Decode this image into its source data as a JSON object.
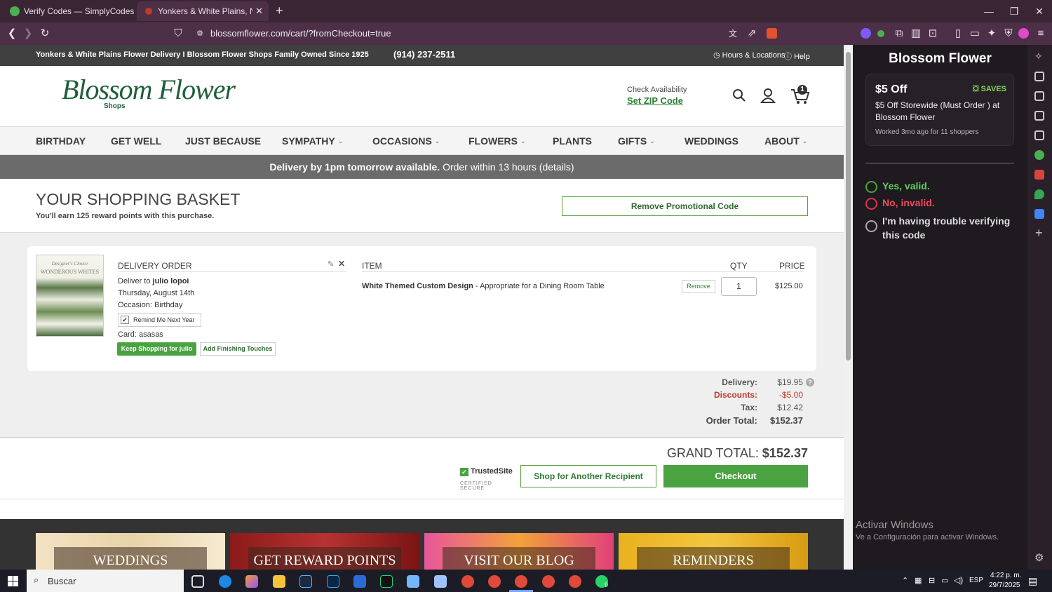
{
  "browser": {
    "tabs": [
      {
        "title": "Verify Codes — SimplyCodes"
      },
      {
        "title": "Yonkers & White Plains, New Yor"
      }
    ],
    "url": "blossomflower.com/cart/?fromCheckout=true"
  },
  "site": {
    "topbar_text": "Yonkers & White Plains Flower Delivery I Blossom Flower Shops Family Owned Since 1925",
    "phone": "(914) 237-2511",
    "hours_label": "Hours & Locations",
    "help_label": "Help",
    "logo_text": "Blossom Flower",
    "logo_sub": "Shops",
    "check_availability": "Check Availability",
    "zip_link": "Set ZIP Code",
    "cart_count": "1",
    "nav": [
      "BIRTHDAY",
      "GET WELL",
      "JUST BECAUSE",
      "SYMPATHY",
      "OCCASIONS",
      "FLOWERS",
      "PLANTS",
      "GIFTS",
      "WEDDINGS",
      "ABOUT"
    ],
    "delivery_banner_bold": "Delivery by 1pm tomorrow available.",
    "delivery_banner_rest": "Order within 13 hours",
    "delivery_banner_link": "(details)"
  },
  "cart": {
    "heading": "YOUR SHOPPING BASKET",
    "reward_text": "You'll earn 125 reward points with this purchase.",
    "remove_promo": "Remove Promotional Code",
    "product_image_caption": "Designer's Choice",
    "product_image_title": "WONDEROUS WHITES",
    "delivery_order_label": "DELIVERY ORDER",
    "deliver_to_prefix": "Deliver to",
    "recipient": "julio lopoi",
    "date": "Thursday, August 14th",
    "occasion": "Occasion: Birthday",
    "remind_label": "Remind Me Next Year",
    "card": "Card: asasas",
    "keep_shopping": "Keep Shopping for julio",
    "finishing_touches": "Add Finishing Touches",
    "col_item": "ITEM",
    "col_qty": "QTY",
    "col_price": "PRICE",
    "item_name": "White Themed Custom Design",
    "item_desc": " - Appropriate for a Dining Room Table",
    "remove_label": "Remove",
    "qty": "1",
    "price": "$125.00",
    "summary": {
      "delivery_label": "Delivery:",
      "delivery": "$19.95",
      "discount_label": "Discounts:",
      "discount": "-$5.00",
      "tax_label": "Tax:",
      "tax": "$12.42",
      "total_label": "Order Total:",
      "total": "$152.37"
    },
    "grand_total_label": "GRAND TOTAL:",
    "grand_total": "$152.37",
    "trusted_site": "TrustedSite",
    "trusted_sub": "CERTIFIED SECURE",
    "another_recipient": "Shop for Another Recipient",
    "checkout": "Checkout"
  },
  "tiles": [
    "WEDDINGS",
    "GET REWARD POINTS",
    "VISIT OUR BLOG",
    "REMINDERS"
  ],
  "side_panel": {
    "title": "Blossom Flower",
    "offer_amount": "$5 Off",
    "saves": "SAVES",
    "offer_desc": "$5 Off Storewide (Must Order ) at Blossom Flower",
    "worked": "Worked 3mo ago for 11 shoppers",
    "valid": "Yes, valid.",
    "invalid": "No, invalid.",
    "trouble": "I'm having trouble verifying this code",
    "activate_title": "Activar Windows",
    "activate_sub": "Ve a Configuración para activar Windows."
  },
  "taskbar": {
    "search_placeholder": "Buscar",
    "lang": "ESP",
    "time": "4:22 p. m.",
    "date": "29/7/2025",
    "whatsapp_badge": "9"
  }
}
